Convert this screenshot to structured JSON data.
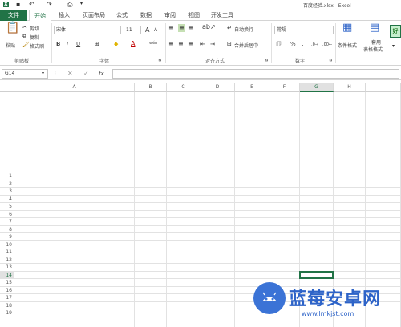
{
  "window": {
    "title": "百度经验.xlsx - Excel"
  },
  "tabs": [
    "文件",
    "开始",
    "插入",
    "页面布局",
    "公式",
    "数据",
    "审阅",
    "视图",
    "开发工具"
  ],
  "ribbon": {
    "clipboard": {
      "paste": "粘贴",
      "cut": "剪切",
      "copy": "复制",
      "format_painter": "格式刷",
      "group": "剪贴板"
    },
    "font": {
      "name": "宋体",
      "size": "11",
      "bold": "B",
      "italic": "I",
      "underline": "U",
      "grow": "A",
      "shrink": "A",
      "color_a": "A",
      "wen": "wén",
      "group": "字体"
    },
    "alignment": {
      "wrap": "自动换行",
      "merge": "合并后居中",
      "group": "对齐方式"
    },
    "number": {
      "format": "常规",
      "percent": "%",
      "comma": ",",
      "group": "数字"
    },
    "styles": {
      "conditional": "条件格式",
      "table_line1": "套用",
      "table_line2": "表格格式",
      "good": "好"
    }
  },
  "formula_bar": {
    "name_box": "G14",
    "fx": "fx",
    "value": ""
  },
  "grid": {
    "columns": [
      "A",
      "B",
      "C",
      "D",
      "E",
      "F",
      "G",
      "H",
      "I"
    ],
    "rows": [
      "1",
      "2",
      "3",
      "4",
      "5",
      "6",
      "7",
      "8",
      "9",
      "10",
      "11",
      "12",
      "13",
      "14",
      "15",
      "16",
      "17",
      "18",
      "19"
    ],
    "active_cell": "G14"
  },
  "watermark": {
    "text": "蓝莓安卓网",
    "url": "www.lmkjst.com"
  },
  "colors": {
    "accent": "#217346",
    "watermark": "#2d63c8"
  }
}
